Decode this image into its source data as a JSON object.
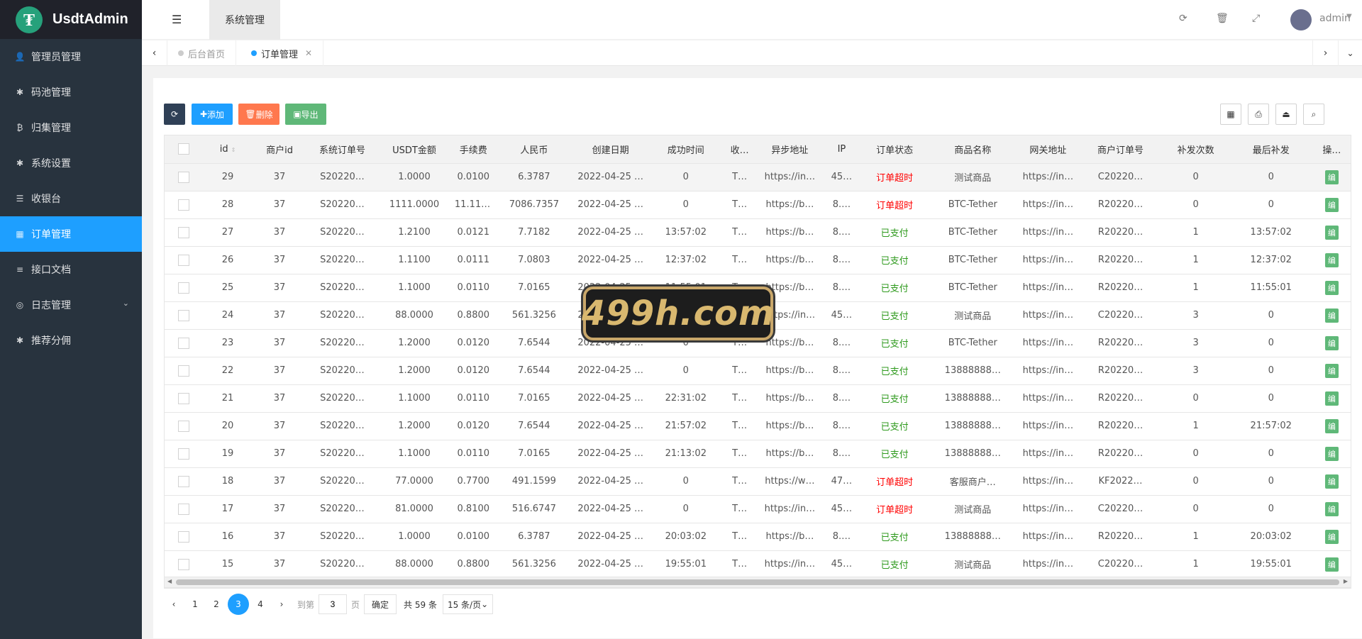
{
  "app": {
    "logo_mark": "₮",
    "title": "UsdtAdmin"
  },
  "sidebar": {
    "items": [
      {
        "label": "管理员管理",
        "icon": "user-icon",
        "glyph": "👤"
      },
      {
        "label": "码池管理",
        "icon": "android-icon",
        "glyph": "✱"
      },
      {
        "label": "归集管理",
        "icon": "bitcoin-icon",
        "glyph": "₿"
      },
      {
        "label": "系统设置",
        "icon": "gear-icon",
        "glyph": "✱"
      },
      {
        "label": "收银台",
        "icon": "list-icon",
        "glyph": "☰"
      },
      {
        "label": "订单管理",
        "icon": "table-icon",
        "glyph": "▦"
      },
      {
        "label": "接口文档",
        "icon": "doc-icon",
        "glyph": "≡"
      },
      {
        "label": "日志管理",
        "icon": "log-icon",
        "glyph": "◎"
      },
      {
        "label": "推荐分佣",
        "icon": "android-icon",
        "glyph": "✱"
      }
    ],
    "active_index": 5
  },
  "header": {
    "toggle_icon": "☰",
    "current_section": "系统管理",
    "user": "admin"
  },
  "tabs": [
    {
      "label": "后台首页"
    },
    {
      "label": "订单管理"
    }
  ],
  "toolbar": {
    "refresh_glyph": "⟳",
    "add_label": "添加",
    "delete_label": "删除",
    "export_label": "导出"
  },
  "table": {
    "columns": [
      "id",
      "商户id",
      "系统订单号",
      "USDT金额",
      "手续费",
      "人民币",
      "创建日期",
      "成功时间",
      "收…",
      "异步地址",
      "IP",
      "订单状态",
      "商品名称",
      "网关地址",
      "商户订单号",
      "补发次数",
      "最后补发",
      "操…"
    ],
    "rows": [
      [
        "29",
        "37",
        "S20220…",
        "1.0000",
        "0.0100",
        "6.3787",
        "2022-04-25 …",
        "0",
        "T…",
        "https://in…",
        "45…",
        "订单超时",
        "测试商品",
        "https://in…",
        "C20220…",
        "0",
        "0"
      ],
      [
        "28",
        "37",
        "S20220…",
        "1111.0000",
        "11.1100",
        "7086.7357",
        "2022-04-25 …",
        "0",
        "T…",
        "https://b…",
        "8.…",
        "订单超时",
        "BTC-Tether",
        "https://in…",
        "R20220…",
        "0",
        "0"
      ],
      [
        "27",
        "37",
        "S20220…",
        "1.2100",
        "0.0121",
        "7.7182",
        "2022-04-25 …",
        "13:57:02",
        "T…",
        "https://b…",
        "8.…",
        "已支付",
        "BTC-Tether",
        "https://in…",
        "R20220…",
        "1",
        "13:57:02"
      ],
      [
        "26",
        "37",
        "S20220…",
        "1.1100",
        "0.0111",
        "7.0803",
        "2022-04-25 …",
        "12:37:02",
        "T…",
        "https://b…",
        "8.…",
        "已支付",
        "BTC-Tether",
        "https://in…",
        "R20220…",
        "1",
        "12:37:02"
      ],
      [
        "25",
        "37",
        "S20220…",
        "1.1000",
        "0.0110",
        "7.0165",
        "2022-04-25 …",
        "11:55:01",
        "T…",
        "https://b…",
        "8.…",
        "已支付",
        "BTC-Tether",
        "https://in…",
        "R20220…",
        "1",
        "11:55:01"
      ],
      [
        "24",
        "37",
        "S20220…",
        "88.0000",
        "0.8800",
        "561.3256",
        "2022-04-25 …",
        "0",
        "T…",
        "https://in…",
        "45…",
        "已支付",
        "测试商品",
        "https://in…",
        "C20220…",
        "3",
        "0"
      ],
      [
        "23",
        "37",
        "S20220…",
        "1.2000",
        "0.0120",
        "7.6544",
        "2022-04-25 …",
        "0",
        "T…",
        "https://b…",
        "8.…",
        "已支付",
        "BTC-Tether",
        "https://in…",
        "R20220…",
        "3",
        "0"
      ],
      [
        "22",
        "37",
        "S20220…",
        "1.2000",
        "0.0120",
        "7.6544",
        "2022-04-25 …",
        "0",
        "T…",
        "https://b…",
        "8.…",
        "已支付",
        "13888888…",
        "https://in…",
        "R20220…",
        "3",
        "0"
      ],
      [
        "21",
        "37",
        "S20220…",
        "1.1000",
        "0.0110",
        "7.0165",
        "2022-04-25 …",
        "22:31:02",
        "T…",
        "https://b…",
        "8.…",
        "已支付",
        "13888888…",
        "https://in…",
        "R20220…",
        "0",
        "0"
      ],
      [
        "20",
        "37",
        "S20220…",
        "1.2000",
        "0.0120",
        "7.6544",
        "2022-04-25 …",
        "21:57:02",
        "T…",
        "https://b…",
        "8.…",
        "已支付",
        "13888888…",
        "https://in…",
        "R20220…",
        "1",
        "21:57:02"
      ],
      [
        "19",
        "37",
        "S20220…",
        "1.1000",
        "0.0110",
        "7.0165",
        "2022-04-25 …",
        "21:13:02",
        "T…",
        "https://b…",
        "8.…",
        "已支付",
        "13888888…",
        "https://in…",
        "R20220…",
        "0",
        "0"
      ],
      [
        "18",
        "37",
        "S20220…",
        "77.0000",
        "0.7700",
        "491.1599",
        "2022-04-25 …",
        "0",
        "T…",
        "https://w…",
        "47…",
        "订单超时",
        "客服商户…",
        "https://in…",
        "KF2022…",
        "0",
        "0"
      ],
      [
        "17",
        "37",
        "S20220…",
        "81.0000",
        "0.8100",
        "516.6747",
        "2022-04-25 …",
        "0",
        "T…",
        "https://in…",
        "45…",
        "订单超时",
        "测试商品",
        "https://in…",
        "C20220…",
        "0",
        "0"
      ],
      [
        "16",
        "37",
        "S20220…",
        "1.0000",
        "0.0100",
        "6.3787",
        "2022-04-25 …",
        "20:03:02",
        "T…",
        "https://b…",
        "8.…",
        "已支付",
        "13888888…",
        "https://in…",
        "R20220…",
        "1",
        "20:03:02"
      ],
      [
        "15",
        "37",
        "S20220…",
        "88.0000",
        "0.8800",
        "561.3256",
        "2022-04-25 …",
        "19:55:01",
        "T…",
        "https://in…",
        "45…",
        "已支付",
        "测试商品",
        "https://in…",
        "C20220…",
        "1",
        "19:55:01"
      ]
    ],
    "edit_label": "编",
    "status_colors": {
      "订单超时": "#ff0000",
      "已支付": "#2f9a1e"
    }
  },
  "pagination": {
    "pages": [
      "1",
      "2",
      "3",
      "4"
    ],
    "current": "3",
    "goto_label": "到第",
    "goto_value": "3",
    "page_unit": "页",
    "confirm_label": "确定",
    "total_label": "共 59 条",
    "page_size": "15 条/页"
  },
  "watermark": "499h.com"
}
